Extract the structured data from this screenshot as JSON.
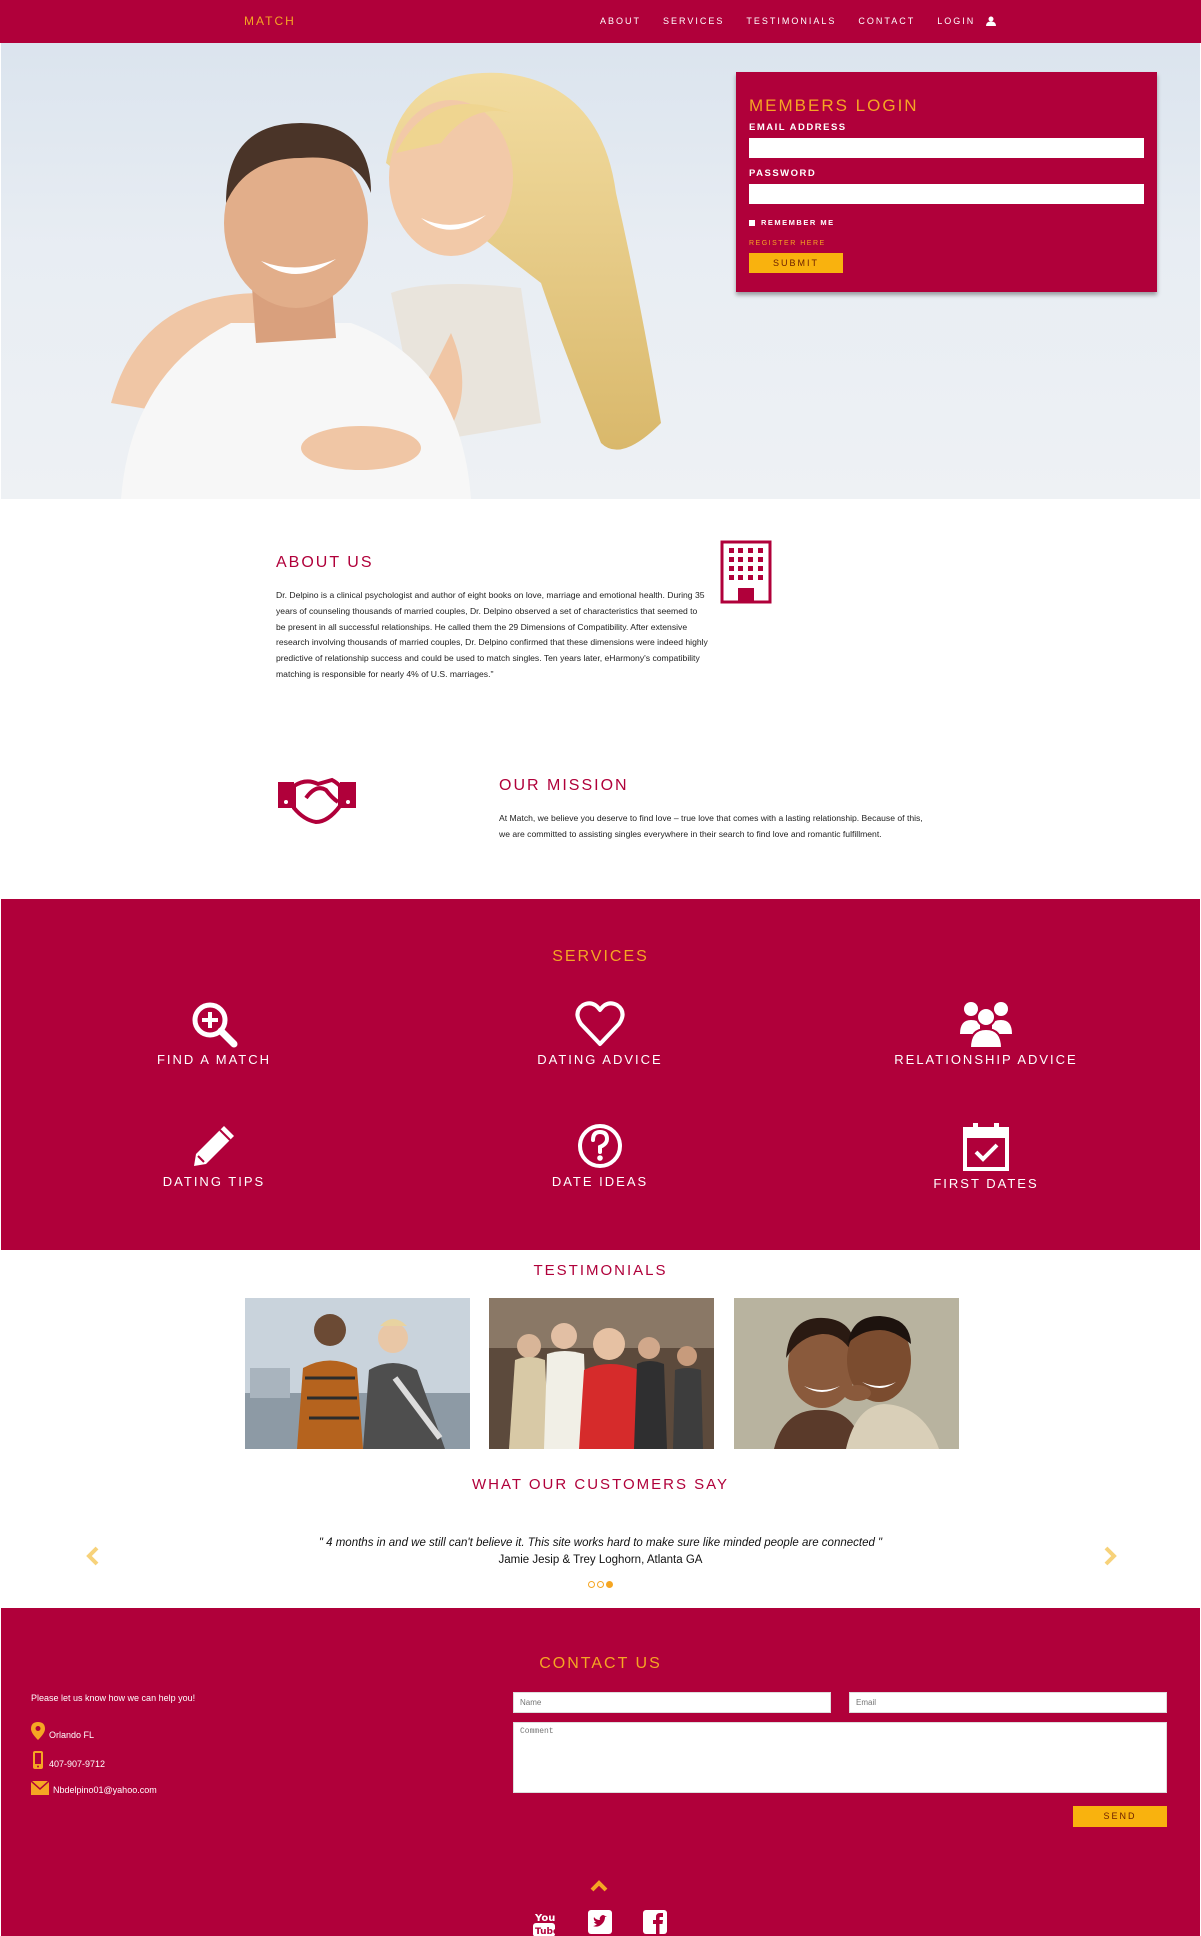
{
  "nav": {
    "brand": "MATCH",
    "links": [
      "ABOUT",
      "SERVICES",
      "TESTIMONIALS",
      "CONTACT",
      "LOGIN"
    ]
  },
  "login": {
    "title": "MEMBERS LOGIN",
    "email_label": "EMAIL ADDRESS",
    "email_value": "",
    "password_label": "PASSWORD",
    "password_value": "",
    "remember_label": "REMEMBER ME",
    "register_label": "REGISTER HERE",
    "submit_label": "SUBMIT"
  },
  "about": {
    "title": "ABOUT US",
    "text": "Dr. Delpino is a clinical psychologist and author of eight books on love, marriage and emotional health. During 35 years of counseling thousands of married couples, Dr. Delpino observed a set of characteristics that seemed to be present in all successful relationships. He called them the 29 Dimensions of Compatibility. After extensive research involving thousands of married couples, Dr. Delpino confirmed that these dimensions were indeed highly predictive of relationship success and could be used to match singles. Ten years later, eHarmony's compatibility matching is responsible for nearly 4% of U.S. marriages.\""
  },
  "mission": {
    "title": "OUR MISSION",
    "text": "At Match, we believe you deserve to find love – true love that comes with a lasting relationship. Because of this, we are committed to assisting singles everywhere in their search to find love and romantic fulfillment."
  },
  "services": {
    "title": "SERVICES",
    "items": [
      {
        "label": "FIND A MATCH",
        "icon": "search-plus-icon"
      },
      {
        "label": "DATING ADVICE",
        "icon": "heart-icon"
      },
      {
        "label": "RELATIONSHIP ADVICE",
        "icon": "group-icon"
      },
      {
        "label": "DATING TIPS",
        "icon": "pencil-icon"
      },
      {
        "label": "DATE IDEAS",
        "icon": "question-icon"
      },
      {
        "label": "FIRST DATES",
        "icon": "calendar-check-icon"
      }
    ]
  },
  "testimonials": {
    "title": "TESTIMONIALS",
    "customers_title": "WHAT OUR CUSTOMERS SAY",
    "quote": "\" 4 months in and we still can't believe it. This site works hard to make sure like minded people are connected \"",
    "author": "Jamie Jesip & Trey Loghorn, Atlanta GA",
    "active_slide": 3,
    "slide_count": 3
  },
  "contact": {
    "title": "CONTACT US",
    "help_text": "Please let us know how we can help you!",
    "location": "Orlando FL",
    "phone": "407-907-9712",
    "email": "Nbdelpino01@yahoo.com",
    "name_placeholder": "Name",
    "email_placeholder": "Email",
    "comment_placeholder": "Comment",
    "send_label": "SEND"
  },
  "social": [
    "youtube-icon",
    "twitter-icon",
    "facebook-icon"
  ],
  "colors": {
    "primary": "#b0003a",
    "accent": "#f5a623",
    "button": "#f9b20e"
  }
}
